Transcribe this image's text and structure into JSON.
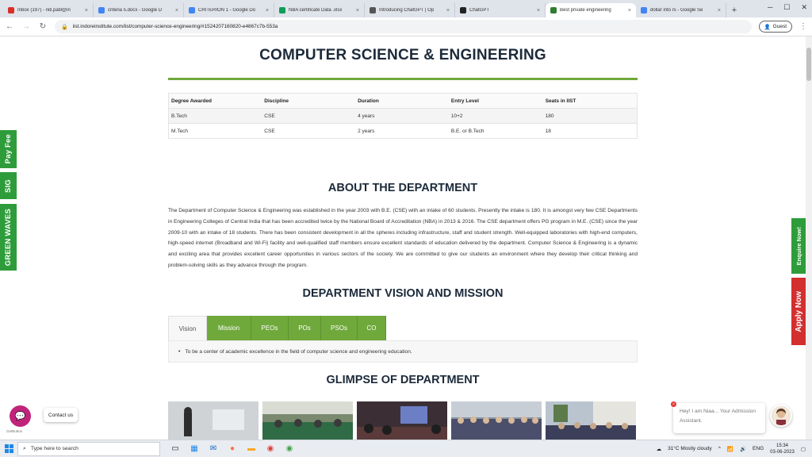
{
  "browser": {
    "tabs": [
      {
        "title": "Inbox (197) - niti.patil@in",
        "color": "#d93025"
      },
      {
        "title": "criteria 5.docx - Google D",
        "color": "#4285f4"
      },
      {
        "title": "CRITERION 1 - Google Do",
        "color": "#4285f4"
      },
      {
        "title": "NBA certificate Data .xlsx",
        "color": "#0f9d58"
      },
      {
        "title": "Introducing ChatGPT | Op",
        "color": "#555555"
      },
      {
        "title": "ChatGPT",
        "color": "#222222"
      },
      {
        "title": "Best private engineering",
        "color": "#2e7d32"
      },
      {
        "title": "dollar into rs - Google Se",
        "color": "#4285f4"
      }
    ],
    "active_tab_index": 6,
    "url": "iist.indoreinstitute.com/iist/computer-science-engineering/#1524207160820-e4867c7b-553a",
    "profile": "Guest"
  },
  "page": {
    "title": "COMPUTER SCIENCE & ENGINEERING",
    "degree_table": {
      "headers": [
        "Degree Awarded",
        "Discipline",
        "Duration",
        "Entry Level",
        "Seats in IIST"
      ],
      "rows": [
        [
          "B.Tech",
          "CSE",
          "4 years",
          "10+2",
          "180"
        ],
        [
          "M.Tech",
          "CSE",
          "2 years",
          "B.E. or B.Tech",
          "18"
        ]
      ]
    },
    "about": {
      "heading": "ABOUT THE DEPARTMENT",
      "text": "The Department of Computer Science & Engineering was established in the year 2003 with B.E. (CSE) with an intake of 60 students. Presently the intake is 180. It is amongst very few CSE Departments in Engineering Colleges of Central India that has been accredited twice by the National Board of Accreditation (NBA) in 2013 & 2016. The CSE department offers PG program in M.E. (CSE) since the year 2009-10 with an intake of 18 students. There has been consistent development in all the spheres including infrastructure, staff and student strength. Well-equipped laboratories with high-end computers, high-speed internet (Broadband and Wi-Fi) facility and well-qualified staff members ensure excellent standards of education delivered by the department. Computer Science & Engineering is a dynamic and exciting area that provides excellent career opportunities in various sectors of the society. We are committed to give our students an environment where they develop their critical thinking and problem-solving skills as they advance through the program."
    },
    "vision_mission": {
      "heading": "DEPARTMENT VISION AND MISSION",
      "tabs": [
        "Vision",
        "Mission",
        "PEOs",
        "POs",
        "PSOs",
        "CO"
      ],
      "active_tab": "Vision",
      "vision_text": "To be a center of academic excellence in the field of computer science and engineering education."
    },
    "glimpse": {
      "heading": "GLIMPSE OF DEPARTMENT"
    },
    "side_left": [
      "Pay Fee",
      "SIG",
      "GREEN WAVES"
    ],
    "side_right": [
      "Enquire Now!",
      "Apply Now"
    ],
    "contact_label": "Contact us",
    "getbutton_label": "GetButton",
    "chat_bubble": "Hey! I am Niaa... Your Admission Assistant."
  },
  "taskbar": {
    "search_placeholder": "Type here to search",
    "weather": "31°C  Mostly cloudy",
    "lang": "ENG",
    "time": "15:34",
    "date": "03-06-2023"
  }
}
